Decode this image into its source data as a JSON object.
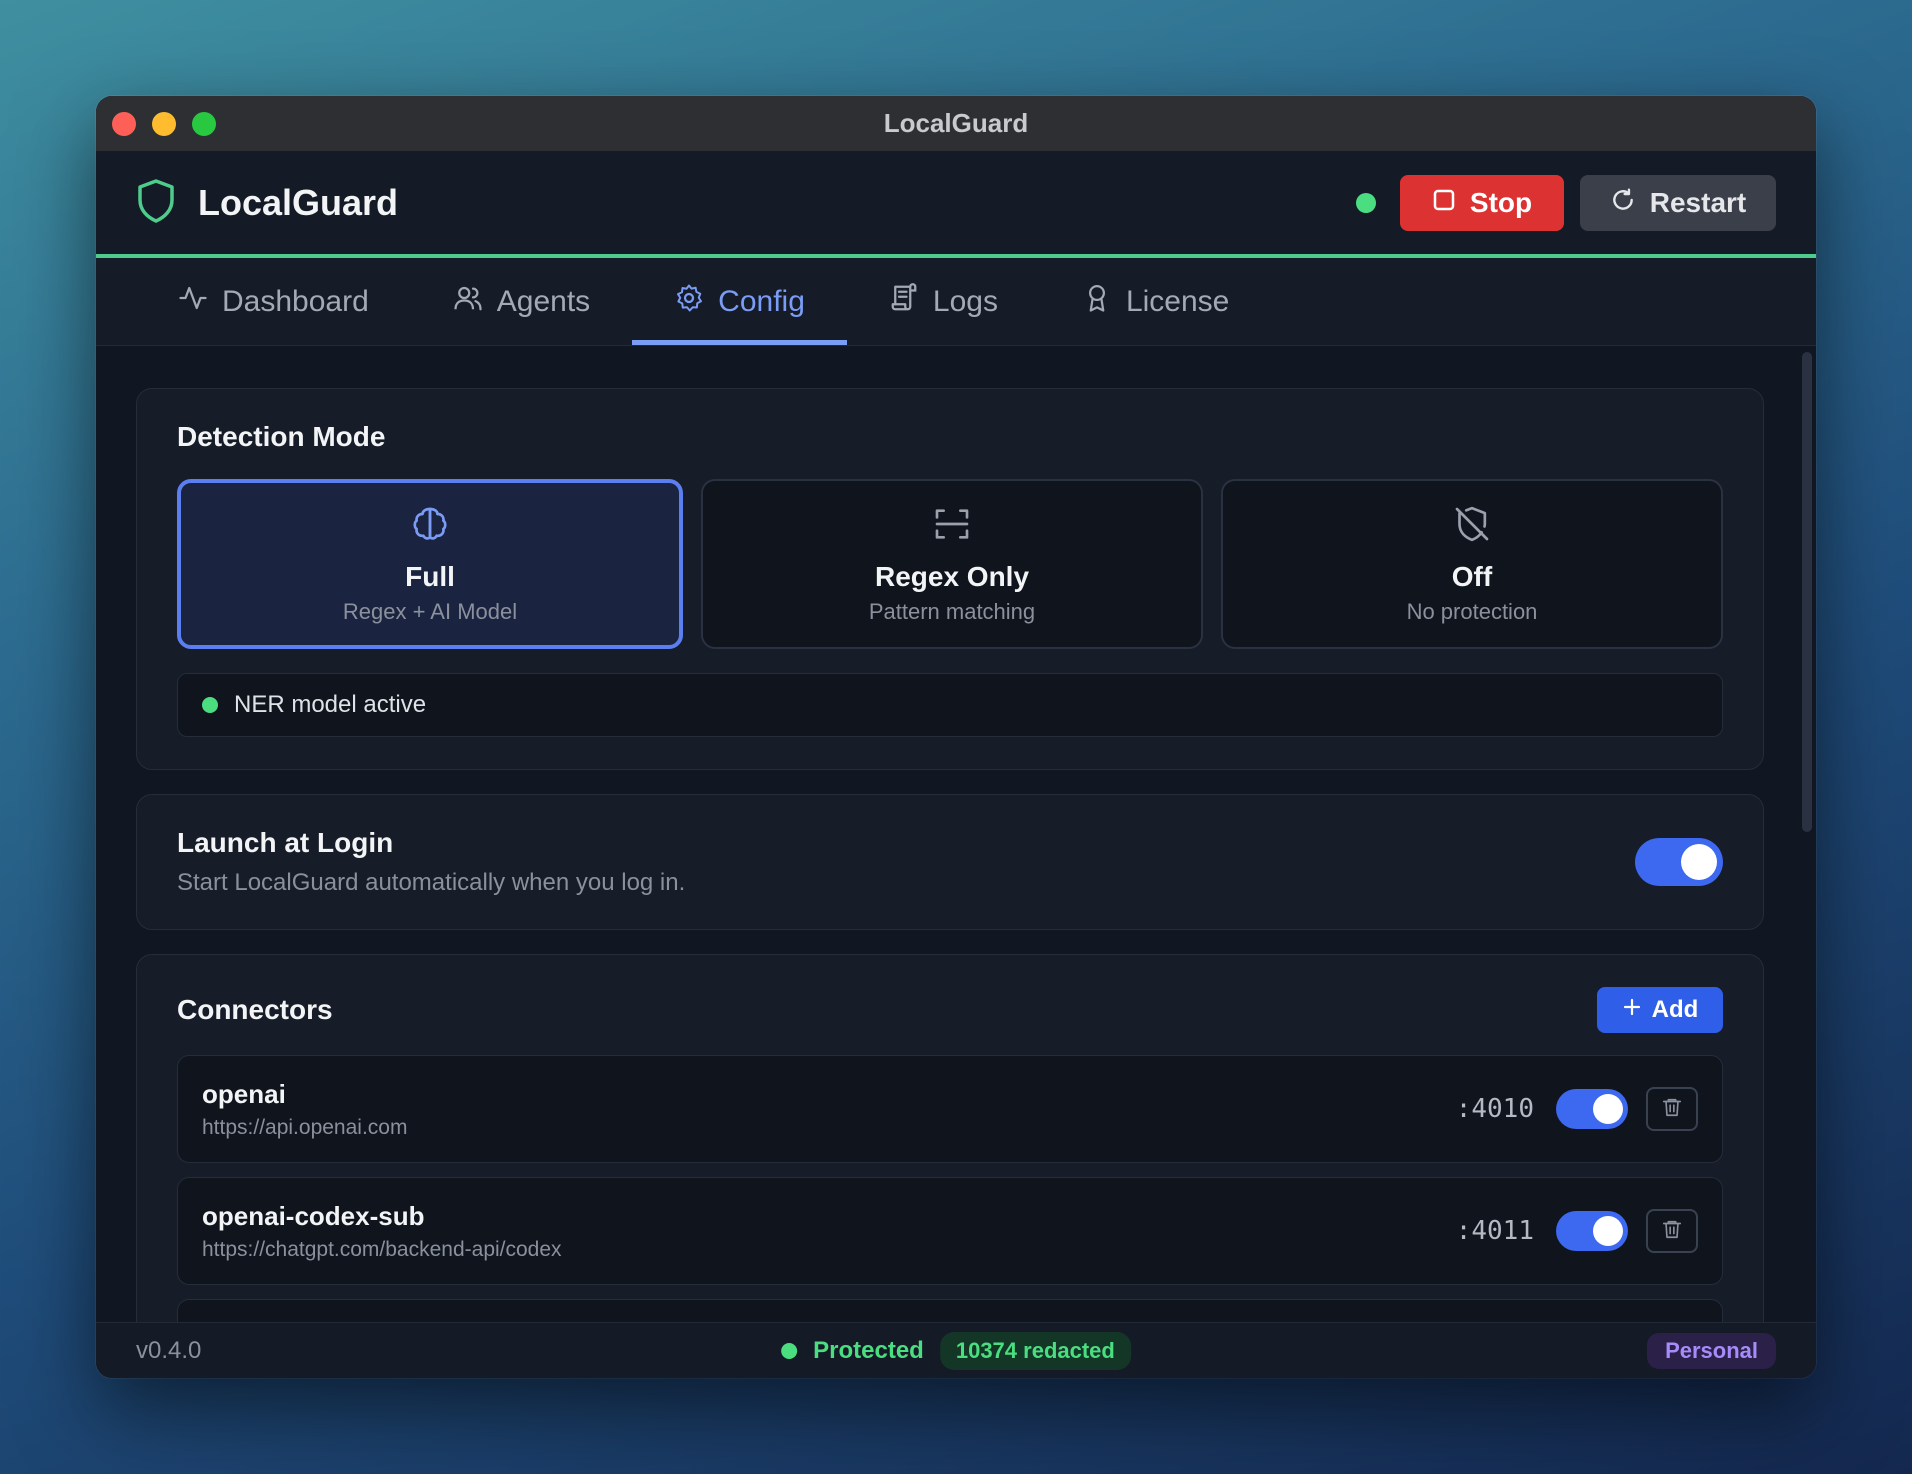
{
  "window": {
    "title": "LocalGuard"
  },
  "header": {
    "brand": "LocalGuard",
    "stop_label": "Stop",
    "restart_label": "Restart",
    "status_color": "#4ade80"
  },
  "tabs": [
    {
      "label": "Dashboard",
      "icon": "activity-icon"
    },
    {
      "label": "Agents",
      "icon": "users-icon"
    },
    {
      "label": "Config",
      "icon": "gear-icon",
      "active": true
    },
    {
      "label": "Logs",
      "icon": "scroll-icon"
    },
    {
      "label": "License",
      "icon": "award-icon"
    }
  ],
  "detection": {
    "title": "Detection Mode",
    "modes": [
      {
        "label": "Full",
        "desc": "Regex + AI Model",
        "icon": "brain-icon",
        "selected": true
      },
      {
        "label": "Regex Only",
        "desc": "Pattern matching",
        "icon": "scan-icon"
      },
      {
        "label": "Off",
        "desc": "No protection",
        "icon": "shield-off-icon"
      }
    ],
    "ner_status": "NER model active"
  },
  "launch": {
    "title": "Launch at Login",
    "desc": "Start LocalGuard automatically when you log in.",
    "enabled": true
  },
  "connectors": {
    "title": "Connectors",
    "add_label": "Add",
    "items": [
      {
        "name": "openai",
        "url": "https://api.openai.com",
        "port": ":4010",
        "enabled": true
      },
      {
        "name": "openai-codex-sub",
        "url": "https://chatgpt.com/backend-api/codex",
        "port": ":4011",
        "enabled": true
      }
    ]
  },
  "footer": {
    "version": "v0.4.0",
    "status": "Protected",
    "redacted": "10374 redacted",
    "plan": "Personal"
  },
  "colors": {
    "accent": "#5b7ff0",
    "stop": "#dc3232",
    "success": "#4ade80",
    "plan": "#a78bfa"
  }
}
